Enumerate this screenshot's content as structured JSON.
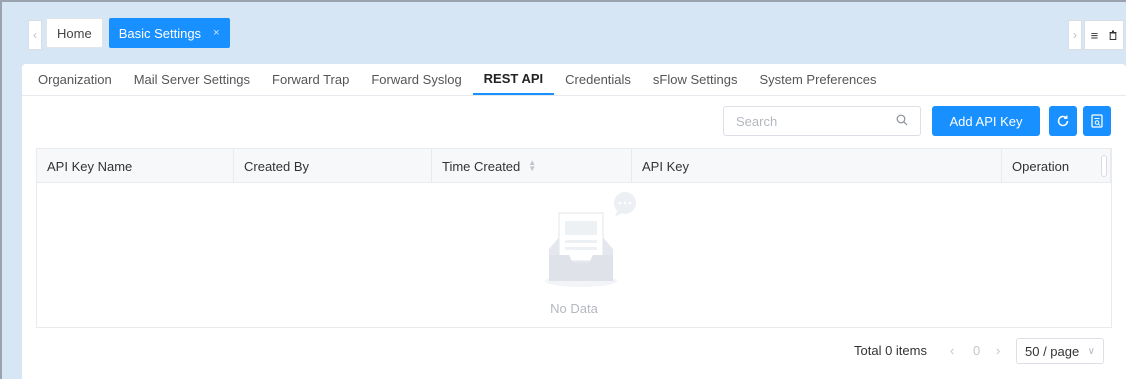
{
  "top_tabs": {
    "prev_icon": "chevron-left-icon",
    "next_icon": "chevron-right-icon",
    "home_label": "Home",
    "active_label": "Basic Settings",
    "close_glyph": "×",
    "menu_icon": "hamburger-icon",
    "trash_icon": "trash-icon"
  },
  "subtabs": [
    {
      "label": "Organization",
      "active": false
    },
    {
      "label": "Mail Server Settings",
      "active": false
    },
    {
      "label": "Forward Trap",
      "active": false
    },
    {
      "label": "Forward Syslog",
      "active": false
    },
    {
      "label": "REST API",
      "active": true
    },
    {
      "label": "Credentials",
      "active": false
    },
    {
      "label": "sFlow Settings",
      "active": false
    },
    {
      "label": "System Preferences",
      "active": false
    }
  ],
  "toolbar": {
    "search_placeholder": "Search",
    "add_label": "Add API Key",
    "refresh_icon": "refresh-icon",
    "export_icon": "export-icon"
  },
  "table": {
    "columns": [
      "API Key Name",
      "Created By",
      "Time Created",
      "API Key",
      "Operation"
    ],
    "rows": [],
    "empty_text": "No Data"
  },
  "pagination": {
    "total_label": "Total 0 items",
    "current_page": "0",
    "page_size": "50 / page"
  },
  "colors": {
    "accent": "#1890ff",
    "frame_bg": "#d7e6f4"
  }
}
